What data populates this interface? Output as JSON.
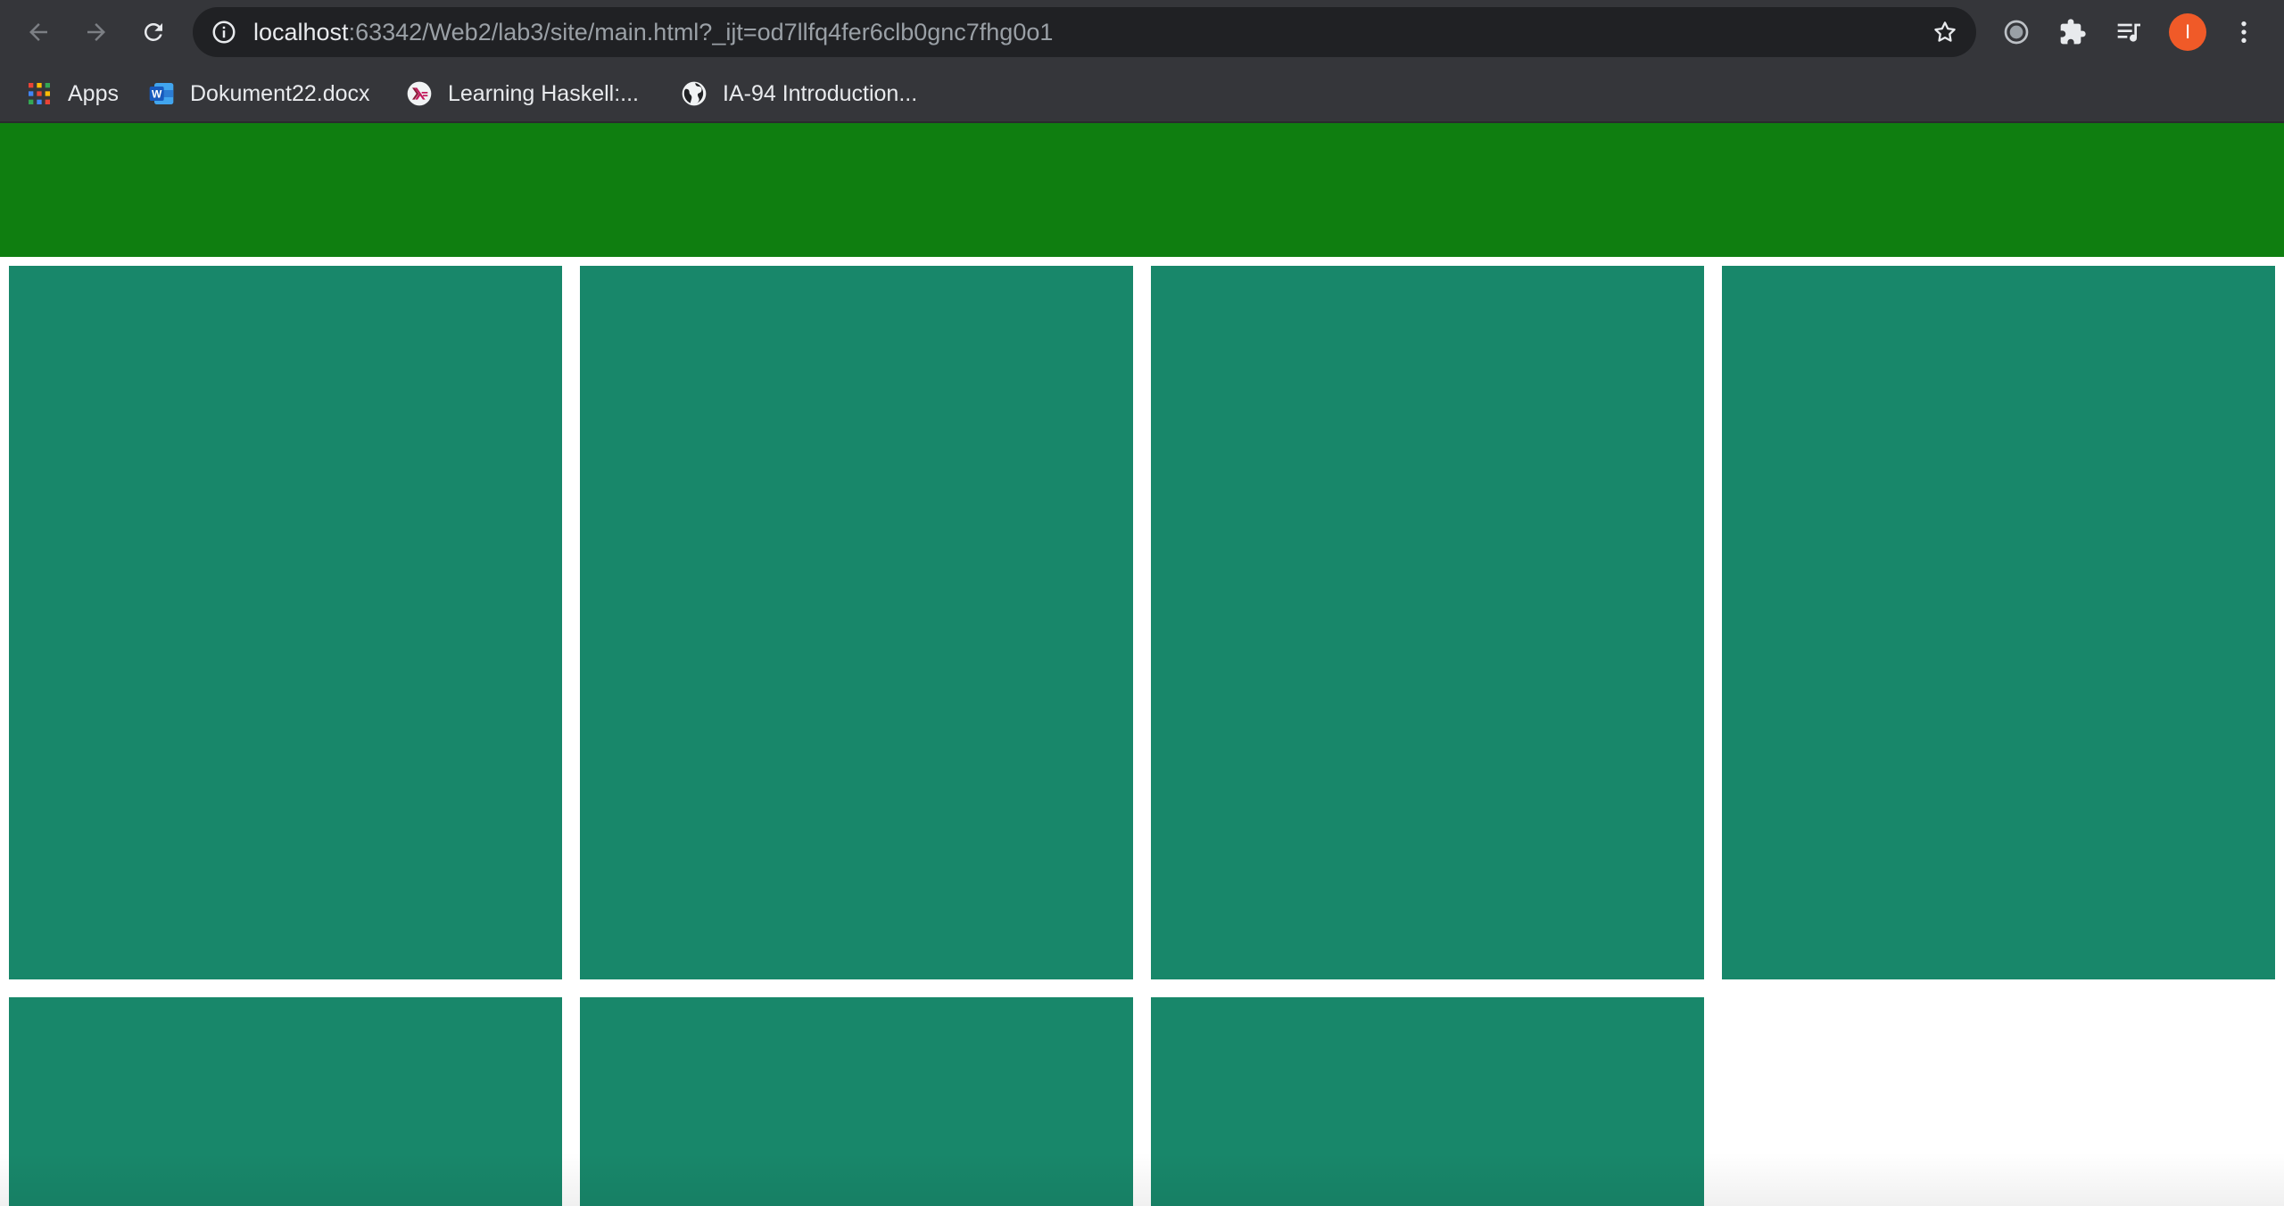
{
  "browser": {
    "url_host": "localhost",
    "url_rest": ":63342/Web2/lab3/site/main.html?_ijt=od7llfq4fer6clb0gnc7fhg0o1",
    "avatar_initial": "I",
    "icons": {
      "back": "arrow-left-icon",
      "forward": "arrow-right-icon",
      "reload": "reload-icon",
      "info": "info-icon",
      "star": "star-icon",
      "extension_circle": "extension-circle-icon",
      "extensions": "puzzle-icon",
      "media": "playlist-icon",
      "menu": "kebab-menu-icon"
    },
    "colors": {
      "toolbar": "#35363a",
      "omnibox": "#202124",
      "avatar": "#f05a28"
    }
  },
  "bookmarks": [
    {
      "label": "Apps",
      "icon": "apps-grid-icon"
    },
    {
      "label": "Dokument22.docx",
      "icon": "word-icon"
    },
    {
      "label": "Learning Haskell:...",
      "icon": "haskell-icon"
    },
    {
      "label": "IA-94 Introduction...",
      "icon": "globe-icon"
    }
  ],
  "page": {
    "colors": {
      "header": "#0f7e10",
      "card": "#18876a",
      "background": "#ffffff"
    },
    "cards_row1_count": 4,
    "cards_row2_count": 3
  }
}
